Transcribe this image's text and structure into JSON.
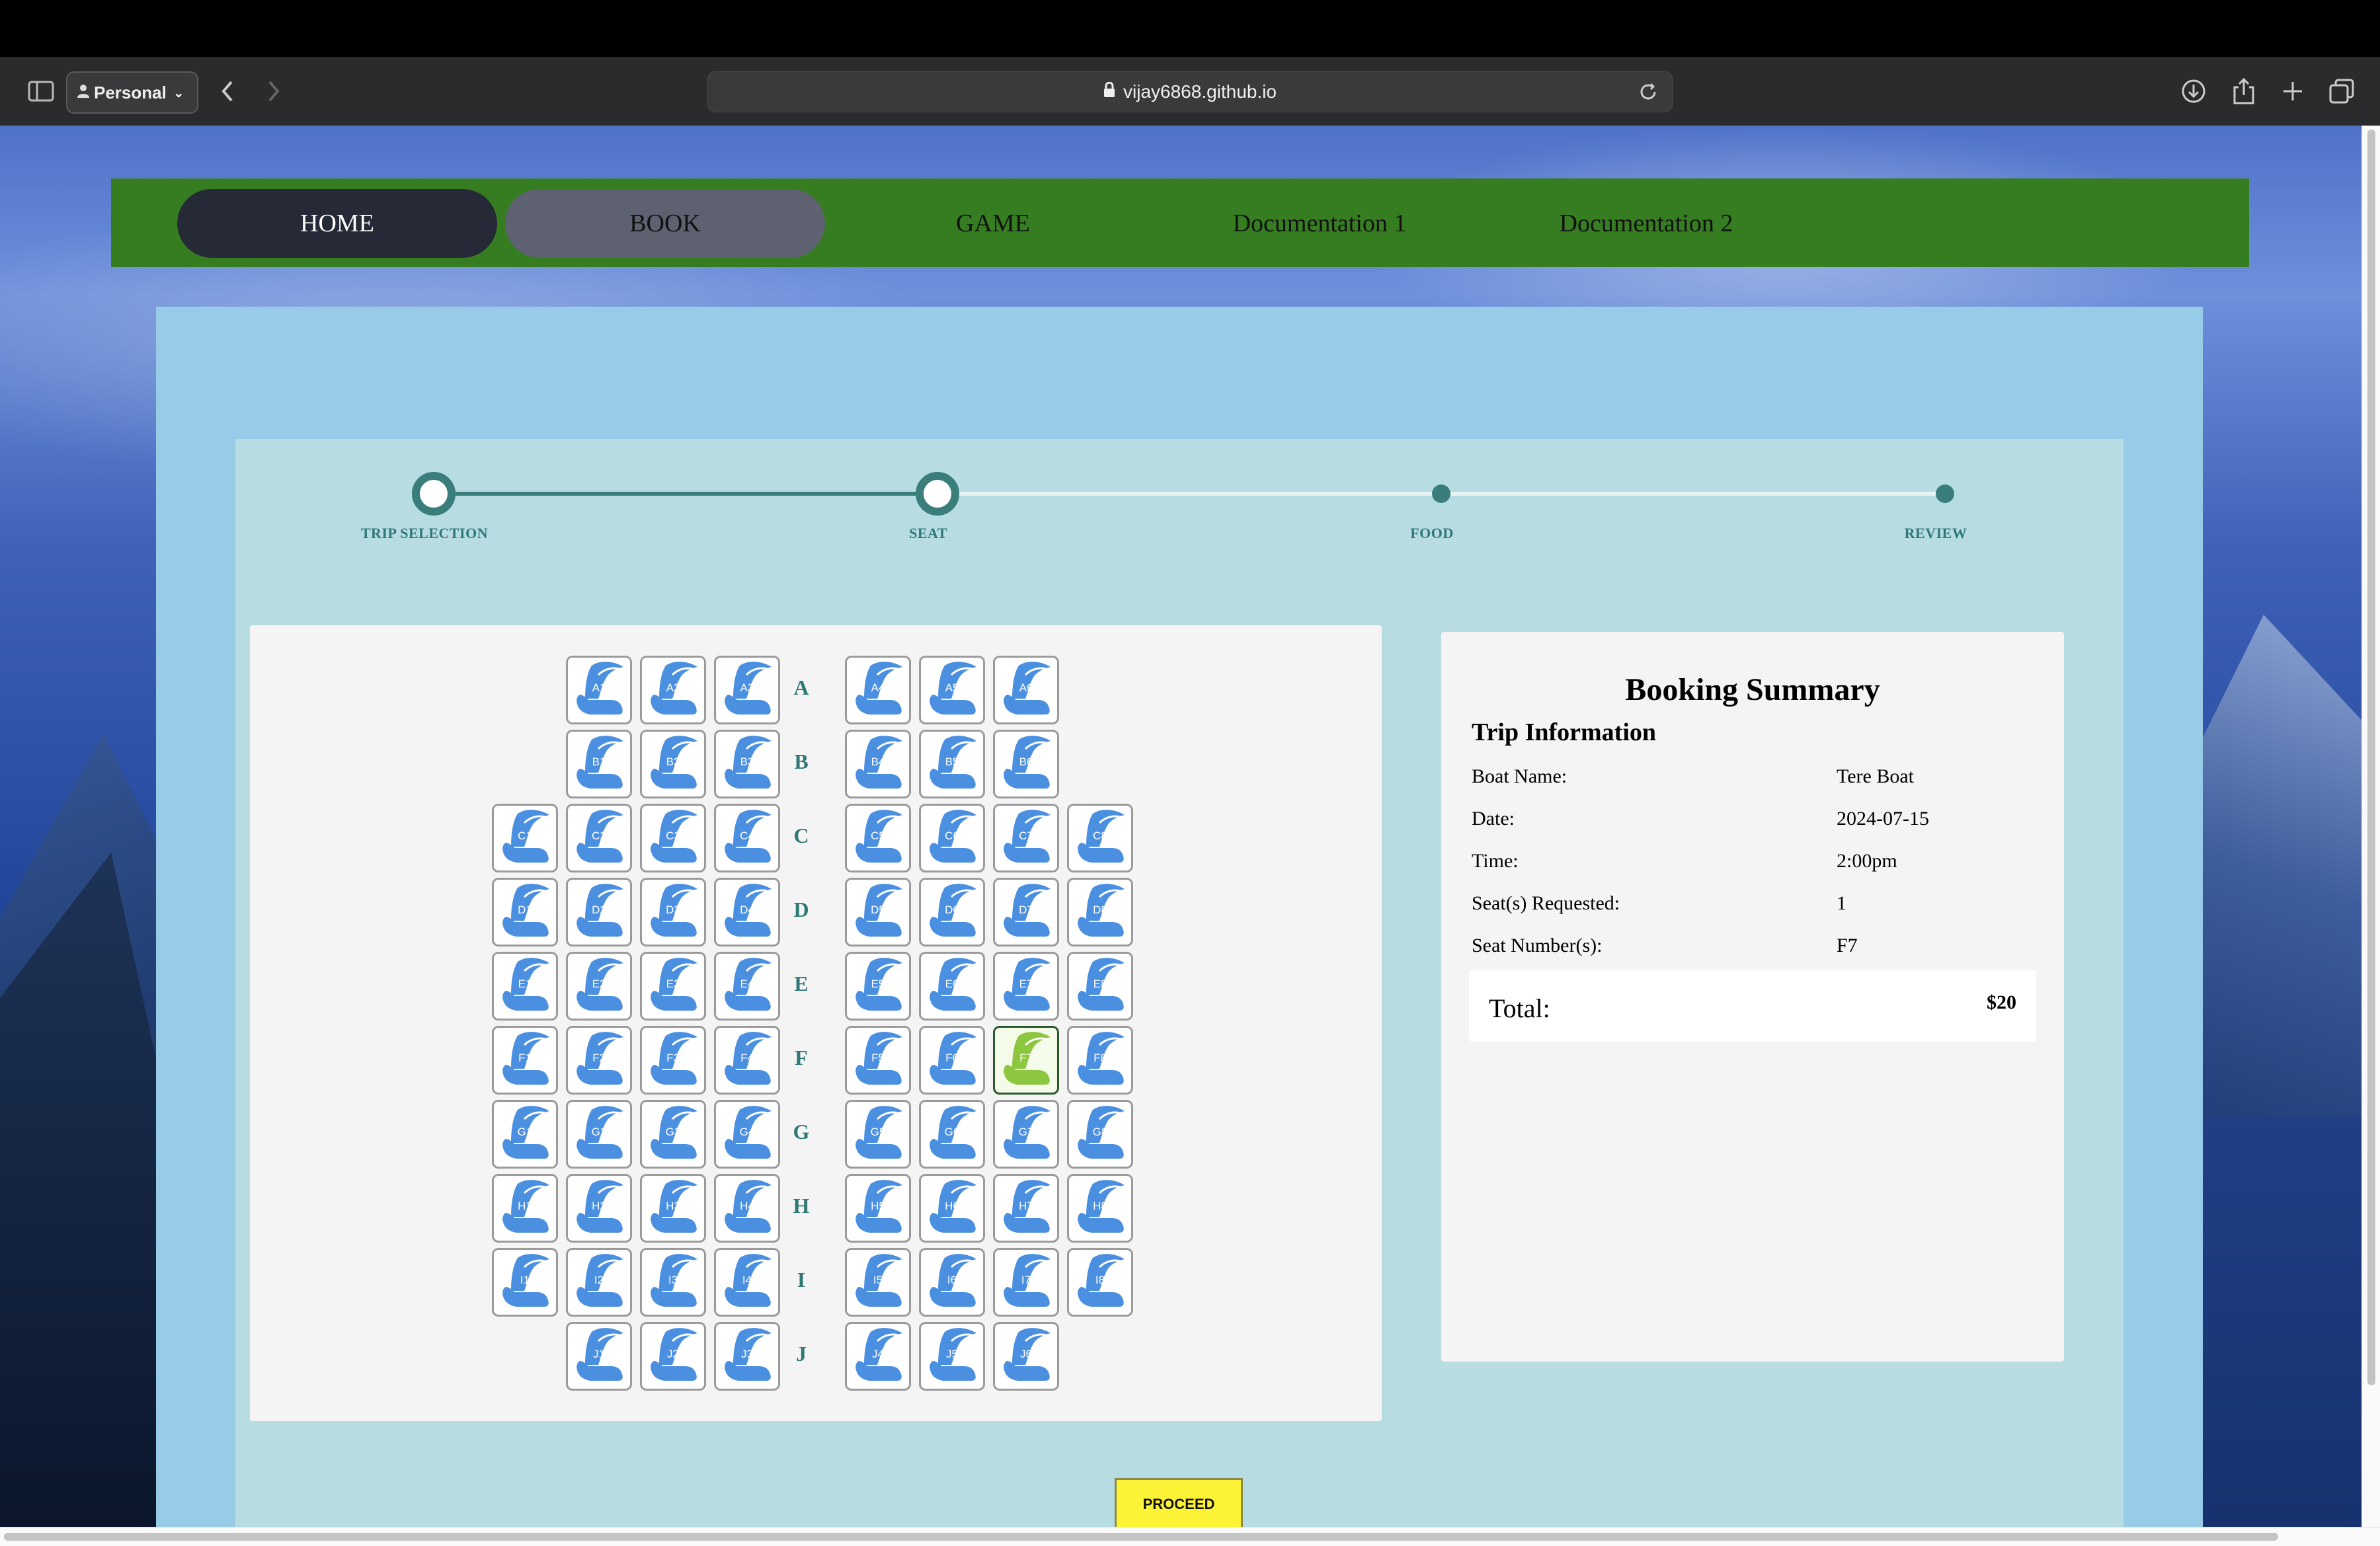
{
  "browser": {
    "profile": "Personal",
    "url": "vijay6868.github.io"
  },
  "nav": {
    "home": "HOME",
    "book": "BOOK",
    "game": "GAME",
    "doc1": "Documentation 1",
    "doc2": "Documentation 2"
  },
  "steps": [
    "TRIP SELECTION",
    "SEAT",
    "FOOD",
    "REVIEW"
  ],
  "current_step": 2,
  "seat_rows": [
    {
      "letter": "A",
      "left": [
        "A1",
        "A2",
        "A3"
      ],
      "right": [
        "A4",
        "A5",
        "A6"
      ]
    },
    {
      "letter": "B",
      "left": [
        "B1",
        "B2",
        "B3"
      ],
      "right": [
        "B4",
        "B5",
        "B6"
      ]
    },
    {
      "letter": "C",
      "left": [
        "C1",
        "C2",
        "C3",
        "C4"
      ],
      "right": [
        "C5",
        "C6",
        "C7",
        "C8"
      ]
    },
    {
      "letter": "D",
      "left": [
        "D1",
        "D2",
        "D3",
        "D4"
      ],
      "right": [
        "D5",
        "D6",
        "D7",
        "D8"
      ]
    },
    {
      "letter": "E",
      "left": [
        "E1",
        "E2",
        "E3",
        "E4"
      ],
      "right": [
        "E5",
        "E6",
        "E7",
        "E8"
      ]
    },
    {
      "letter": "F",
      "left": [
        "F1",
        "F2",
        "F3",
        "F4"
      ],
      "right": [
        "F5",
        "F6",
        "F7",
        "F8"
      ]
    },
    {
      "letter": "G",
      "left": [
        "G1",
        "G2",
        "G3",
        "G4"
      ],
      "right": [
        "G5",
        "G6",
        "G7",
        "G8"
      ]
    },
    {
      "letter": "H",
      "left": [
        "H1",
        "H2",
        "H3",
        "H4"
      ],
      "right": [
        "H5",
        "H6",
        "H7",
        "H8"
      ]
    },
    {
      "letter": "I",
      "left": [
        "I1",
        "I2",
        "I3",
        "I4"
      ],
      "right": [
        "I5",
        "I6",
        "I7",
        "I8"
      ]
    },
    {
      "letter": "J",
      "left": [
        "J1",
        "J2",
        "J3"
      ],
      "right": [
        "J4",
        "J5",
        "J6"
      ]
    }
  ],
  "selected_seat": "F7",
  "colors": {
    "seat_available": "#4a8fe0",
    "seat_selected": "#8dc63f",
    "nav_bg": "#367d22",
    "accent": "#3a7e7c",
    "proceed_bg": "#fcf236"
  },
  "summary": {
    "title": "Booking Summary",
    "subtitle": "Trip Information",
    "rows": [
      {
        "label": "Boat Name:",
        "value": "Tere Boat"
      },
      {
        "label": "Date:",
        "value": "2024-07-15"
      },
      {
        "label": "Time:",
        "value": "2:00pm"
      },
      {
        "label": "Seat(s) Requested:",
        "value": "1"
      },
      {
        "label": "Seat Number(s):",
        "value": "F7"
      }
    ],
    "total_label": "Total:",
    "total_value": "$20"
  },
  "proceed_label": "PROCEED"
}
